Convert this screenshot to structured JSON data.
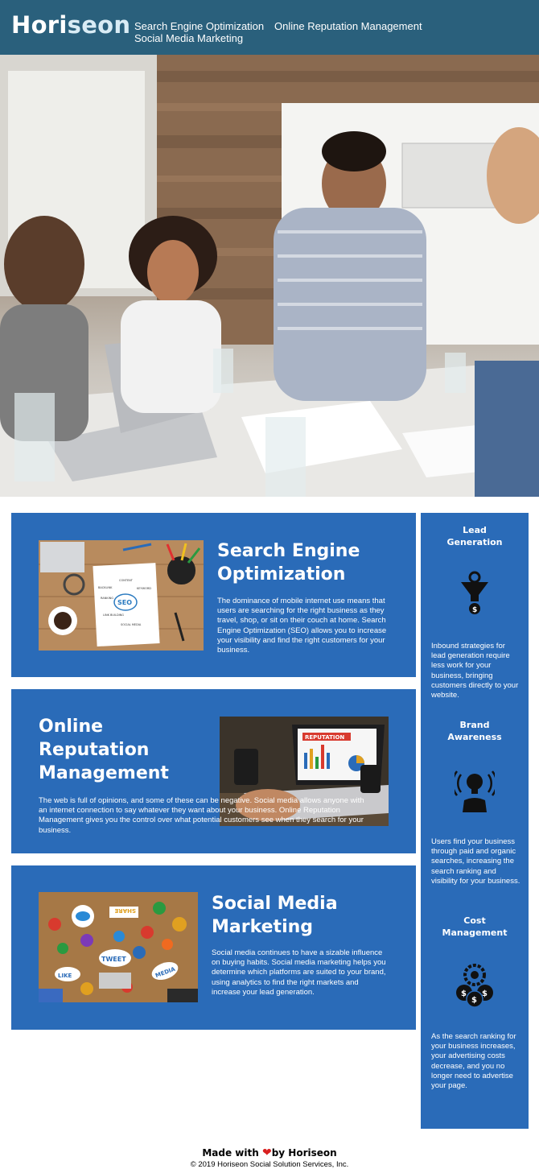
{
  "header": {
    "logo_main": "Hori",
    "logo_accent": "seon",
    "nav": {
      "seo": "Search Engine Optimization",
      "orm": "Online Reputation Management",
      "smm": "Social Media Marketing"
    }
  },
  "cards": {
    "seo": {
      "title_line1": "Search Engine",
      "title_line2": "Optimization",
      "text": "The dominance of mobile internet use means that users are searching for the right business as they travel, shop, or sit on their couch at home. Search Engine Optimization (SEO) allows you to increase your visibility and find the right customers for your business.",
      "image_labels": {
        "seo": "SEO",
        "content": "CONTENT",
        "backlink": "BACKLINK",
        "keyword": "KEYWORD",
        "ranking": "RANKING",
        "link_building": "LINK BUILDING",
        "social_media": "SOCIAL MEDIA"
      }
    },
    "orm": {
      "title_line1": "Online",
      "title_line2": "Reputation",
      "title_line3": "Management",
      "text": "The web is full of opinions, and some of these can be negative. Social media allows anyone with an internet connection to say whatever they want about your business. Online Reputation Management gives you the control over what potential customers see when they search for your business.",
      "image_label": "REPUTATION"
    },
    "smm": {
      "title_line1": "Social Media",
      "title_line2": "Marketing",
      "text": "Social media continues to have a sizable influence on buying habits. Social media marketing helps you determine which platforms are suited to your brand, using analytics to find the right markets and increase your lead generation.",
      "image_labels": {
        "share": "SHARE",
        "tweet": "TWEET",
        "like": "LIKE",
        "media": "MEDIA"
      }
    }
  },
  "benefits": {
    "lead": {
      "title_line1": "Lead",
      "title_line2": "Generation",
      "text": "Inbound strategies for lead generation require less work for your business, bringing customers directly to your website.",
      "icon": "lead-funnel-icon"
    },
    "brand": {
      "title_line1": "Brand",
      "title_line2": "Awareness",
      "text": "Users find your business through paid and organic searches, increasing the search ranking and visibility for your business.",
      "icon": "lightbulb-head-icon"
    },
    "cost": {
      "title_line1": "Cost",
      "title_line2": "Management",
      "text": "As the search ranking for your business increases, your advertising costs decrease, and you no longer need to advertise your page.",
      "icon": "dollar-gears-icon"
    }
  },
  "footer": {
    "made_with": "Made with",
    "by": "by Horiseon",
    "copyright": "© 2019 Horiseon Social Solution Services, Inc."
  },
  "colors": {
    "header_bg": "#2a607c",
    "card_bg": "#2a6bb8",
    "heart": "#d92020"
  }
}
